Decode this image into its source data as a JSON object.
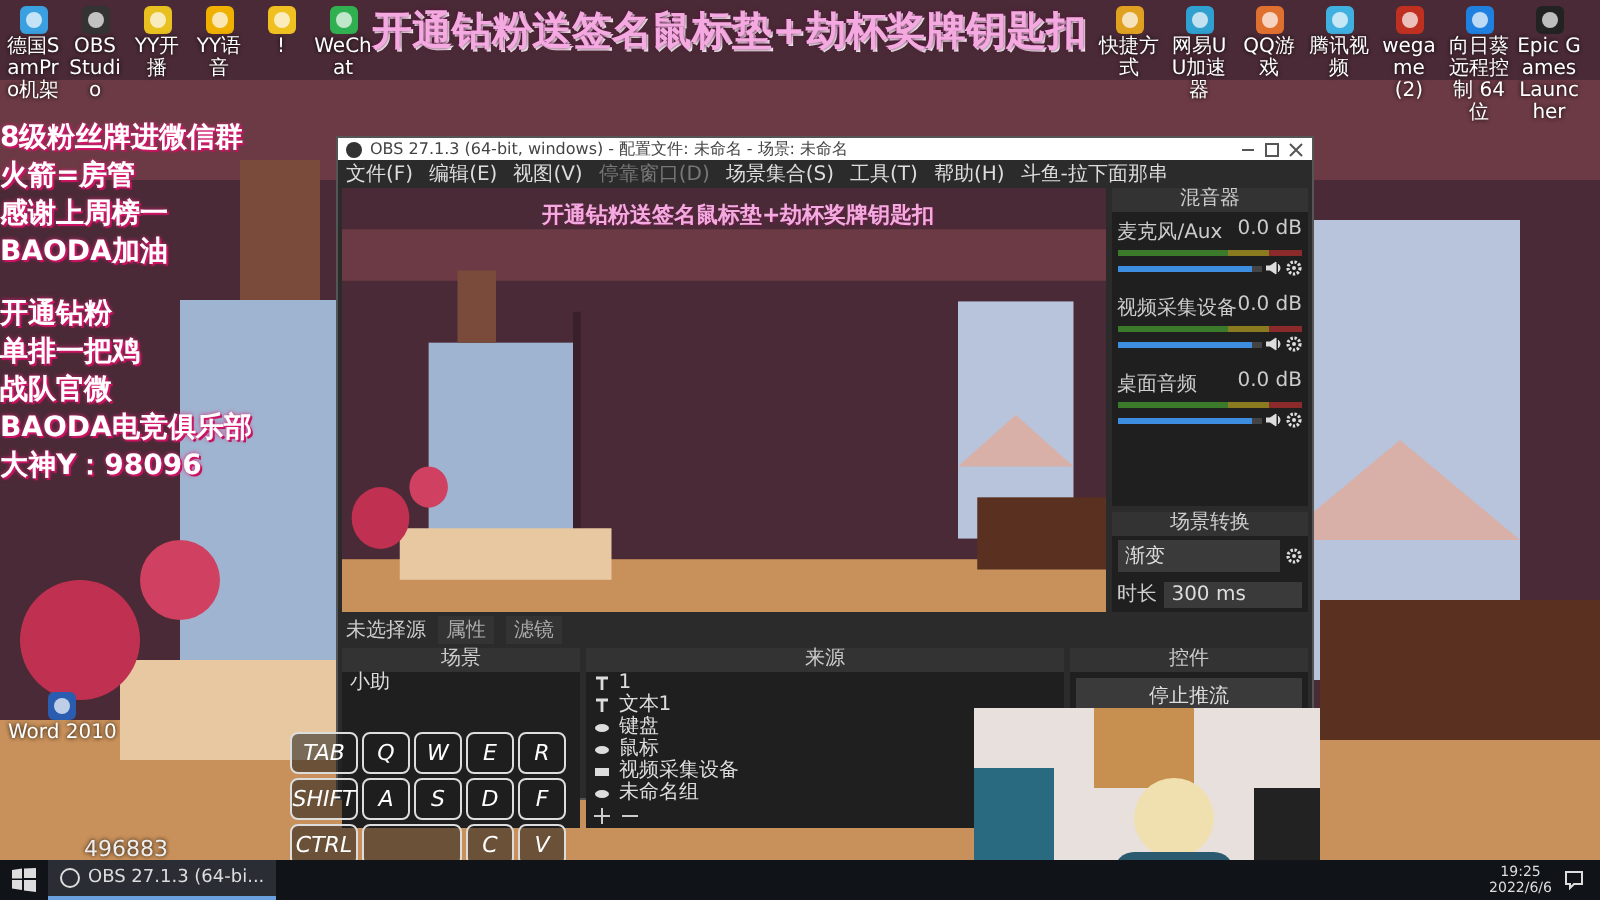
{
  "desktop_icons_left": [
    {
      "label": "德国SamPro机架"
    },
    {
      "label": "OBS Studio"
    },
    {
      "label": "YY开播"
    },
    {
      "label": "YY语音"
    },
    {
      "label": "!"
    },
    {
      "label": "WeChat"
    }
  ],
  "banner": "开通钻粉送签名鼠标垫+劫杯奖牌钥匙扣",
  "desktop_icons_right": [
    {
      "label": "快捷方式"
    },
    {
      "label": "网易UU加速器"
    },
    {
      "label": "QQ游戏"
    },
    {
      "label": "腾讯视频"
    },
    {
      "label": "wegame (2)"
    },
    {
      "label": "向日葵远程控制 64位"
    },
    {
      "label": "Epic Games Launcher"
    }
  ],
  "overlay_top": [
    "8级粉丝牌进微信群",
    "火箭=房管",
    "感谢上周榜一",
    "BAODA加油"
  ],
  "overlay_bottom": [
    "开通钻粉",
    "单排一把鸡",
    "战队官微",
    "BAODA电竞俱乐部",
    "大神Y：98096"
  ],
  "side_icon": {
    "label": "Word 2010"
  },
  "obs": {
    "title": "OBS 27.1.3 (64-bit, windows) - 配置文件: 未命名 - 场景: 未命名",
    "menu": [
      {
        "label": "文件(F)",
        "disabled": false
      },
      {
        "label": "编辑(E)",
        "disabled": false
      },
      {
        "label": "视图(V)",
        "disabled": false
      },
      {
        "label": "停靠窗口(D)",
        "disabled": true
      },
      {
        "label": "场景集合(S)",
        "disabled": false
      },
      {
        "label": "工具(T)",
        "disabled": false
      },
      {
        "label": "帮助(H)",
        "disabled": false
      },
      {
        "label": "斗鱼-拉下面那串",
        "disabled": false
      }
    ],
    "preview_banner": "开通钻粉送签名鼠标垫+劫杯奖牌钥匙扣",
    "mixer": {
      "title": "混音器",
      "channels": [
        {
          "name": "麦克风/Aux",
          "reading": "0.0 dB",
          "level": 0.93
        },
        {
          "name": "视频采集设备",
          "reading": "0.0 dB",
          "level": 0.93
        },
        {
          "name": "桌面音频",
          "reading": "0.0 dB",
          "level": 0.93
        }
      ]
    },
    "transitions": {
      "title": "场景转换",
      "type": "渐变",
      "duration_label": "时长",
      "duration": "300 ms"
    },
    "source_bar": {
      "label": "未选择源",
      "buttons": [
        "属性",
        "滤镜"
      ]
    },
    "scenes": {
      "title": "场景",
      "items": [
        {
          "label": "小助",
          "selected": false
        }
      ]
    },
    "sources": {
      "title": "来源",
      "items": [
        {
          "kind": "text",
          "label": "1"
        },
        {
          "kind": "text",
          "label": "文本1"
        },
        {
          "kind": "capture",
          "label": "键盘"
        },
        {
          "kind": "capture",
          "label": "鼠标"
        },
        {
          "kind": "camera",
          "label": "视频采集设备"
        },
        {
          "kind": "capture",
          "label": "未命名组"
        }
      ]
    },
    "controls": {
      "title": "控件",
      "buttons": [
        "停止推流"
      ]
    }
  },
  "keys": [
    [
      "TAB",
      "Q",
      "W",
      "E",
      "R"
    ],
    [
      "SHIFT",
      "A",
      "S",
      "D",
      "F"
    ],
    [
      "CTRL",
      "C",
      "V"
    ]
  ],
  "room_number": "496883",
  "taskbar": {
    "task": "OBS 27.1.3 (64-bi...",
    "time": "19:25",
    "date": "2022/6/6"
  }
}
